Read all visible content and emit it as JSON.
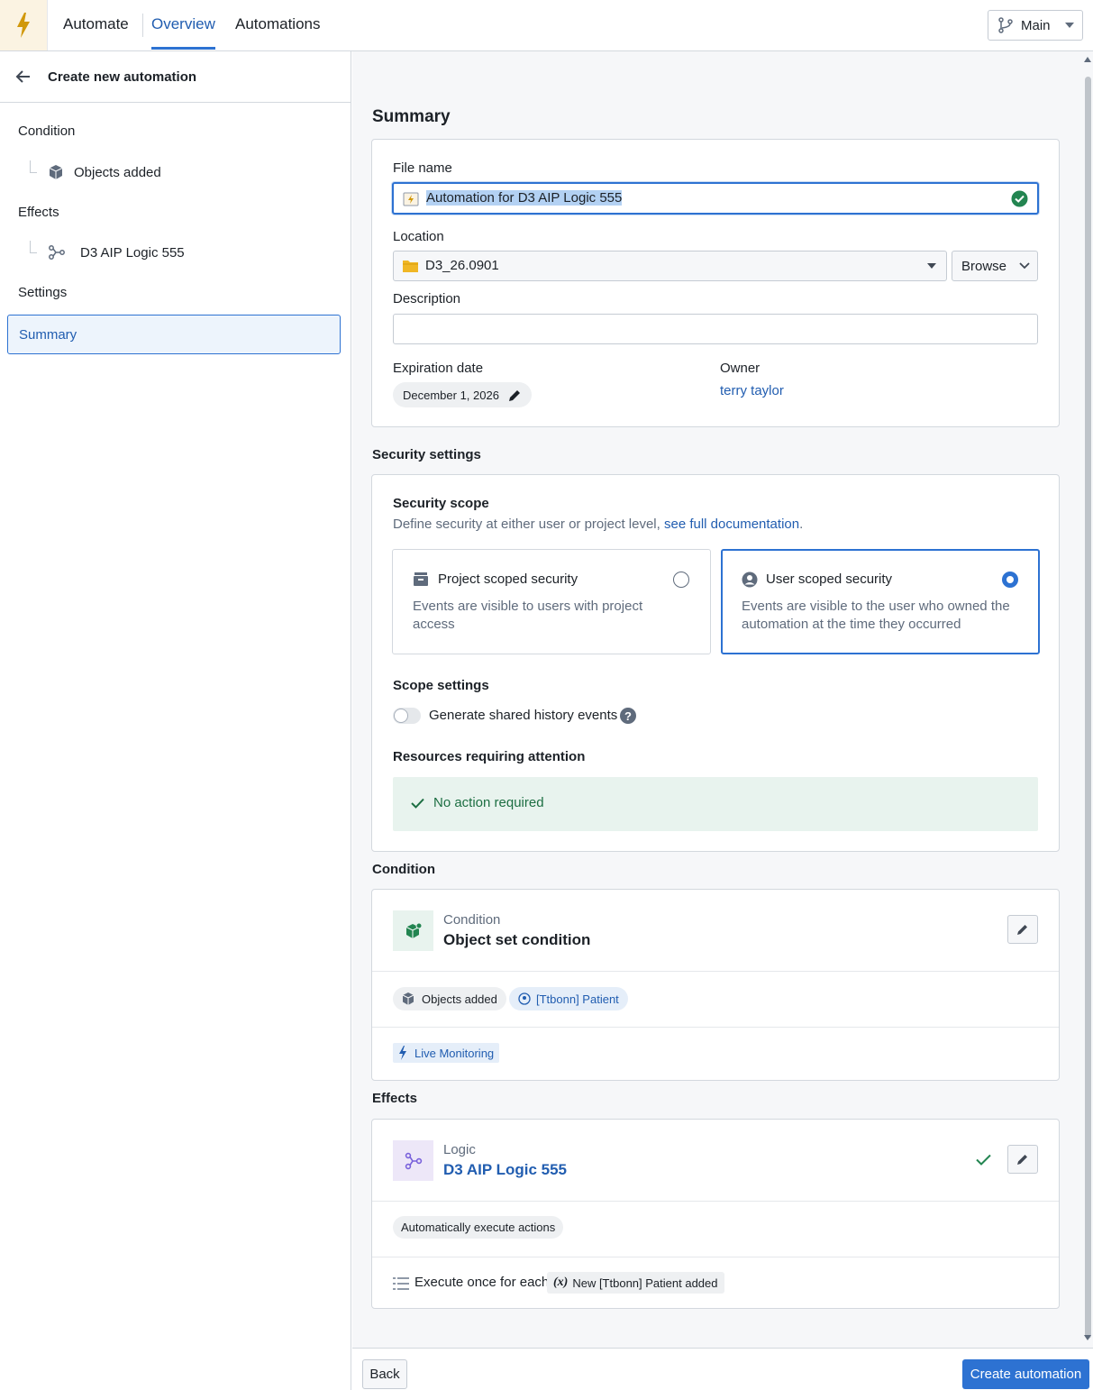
{
  "app": {
    "title": "Automate",
    "tabs": [
      {
        "label": "Overview"
      },
      {
        "label": "Automations"
      }
    ],
    "branch": "Main",
    "accent": "#2d72d2"
  },
  "sidebar": {
    "title": "Create new automation",
    "sections": {
      "condition": "Condition",
      "condition_item": "Objects added",
      "effects": "Effects",
      "effects_item": "D3 AIP Logic 555",
      "settings": "Settings",
      "summary": "Summary"
    }
  },
  "summary": {
    "heading": "Summary",
    "file_name_label": "File name",
    "file_name_value": "Automation for D3 AIP Logic 555",
    "location_label": "Location",
    "location_value": "D3_26.0901",
    "browse_label": "Browse",
    "description_label": "Description",
    "description_value": "",
    "expiration_label": "Expiration date",
    "expiration_value": "December 1, 2026",
    "owner_label": "Owner",
    "owner_value": "terry taylor"
  },
  "security": {
    "heading": "Security settings",
    "scope_title": "Security scope",
    "scope_desc": "Define security at either user or project level,",
    "scope_link": "see full documentation",
    "scope_period": ".",
    "project": {
      "title": "Project scoped security",
      "desc": "Events are visible to users with project access",
      "selected": false
    },
    "user": {
      "title": "User scoped security",
      "desc": "Events are visible to the user who owned the automation at the time they occurred",
      "selected": true
    },
    "scope_settings_title": "Scope settings",
    "toggle_label": "Generate shared history events",
    "toggle_on": false,
    "resources_title": "Resources requiring attention",
    "resources_status": "No action required"
  },
  "condition": {
    "heading": "Condition",
    "kind": "Condition",
    "name": "Object set condition",
    "chip_objects": "Objects added",
    "chip_type": "[Ttbonn] Patient",
    "chip_monitor": "Live Monitoring"
  },
  "effects": {
    "heading": "Effects",
    "kind": "Logic",
    "name": "D3 AIP Logic 555",
    "chip_auto": "Automatically execute actions",
    "execute_label": "Execute once for each",
    "execute_var_icon": "(x)",
    "execute_var": "New [Ttbonn] Patient added"
  },
  "footer": {
    "back": "Back",
    "create": "Create automation"
  },
  "icons": {
    "logo": "lightning-icon",
    "branch": "branch-icon",
    "back": "arrow-left-icon",
    "objects": "cube-add-icon",
    "logic": "logic-graph-icon",
    "check": "check-circle-icon",
    "folder": "folder-icon",
    "edit": "pencil-icon",
    "help": "help-icon"
  }
}
